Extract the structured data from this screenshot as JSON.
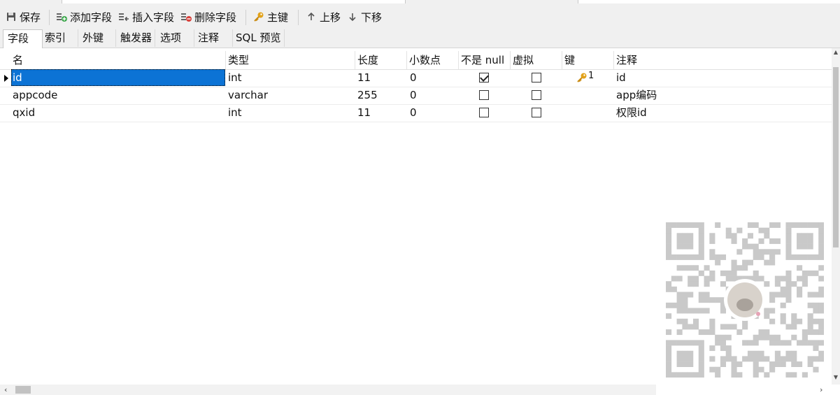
{
  "toolbar": {
    "save_label": "保存",
    "add_field_label": "添加字段",
    "insert_field_label": "插入字段",
    "delete_field_label": "删除字段",
    "primary_key_label": "主键",
    "move_up_label": "上移",
    "move_down_label": "下移"
  },
  "subtabs": [
    "字段",
    "索引",
    "外键",
    "触发器",
    "选项",
    "注释",
    "SQL 预览"
  ],
  "active_subtab": "字段",
  "columns": [
    "名",
    "类型",
    "长度",
    "小数点",
    "不是 null",
    "虚拟",
    "键",
    "注释"
  ],
  "rows": [
    {
      "name": "id",
      "type": "int",
      "length": "11",
      "decimals": "0",
      "not_null": true,
      "virtual": false,
      "key": "1",
      "comment": "id",
      "selected": true
    },
    {
      "name": "appcode",
      "type": "varchar",
      "length": "255",
      "decimals": "0",
      "not_null": false,
      "virtual": false,
      "key": "",
      "comment": "app编码",
      "selected": false
    },
    {
      "name": "qxid",
      "type": "int",
      "length": "11",
      "decimals": "0",
      "not_null": false,
      "virtual": false,
      "key": "",
      "comment": "权限id",
      "selected": false
    }
  ],
  "colors": {
    "selection": "#0c73d5",
    "key_icon": "#e2a21a",
    "toolbar_bg": "#f0f0f0"
  },
  "icons": {
    "save": "floppy-disk-icon",
    "add_field": "add-field-icon",
    "insert_field": "insert-field-icon",
    "delete_field": "delete-field-icon",
    "primary_key": "key-icon",
    "move_up": "arrow-up-icon",
    "move_down": "arrow-down-icon"
  }
}
